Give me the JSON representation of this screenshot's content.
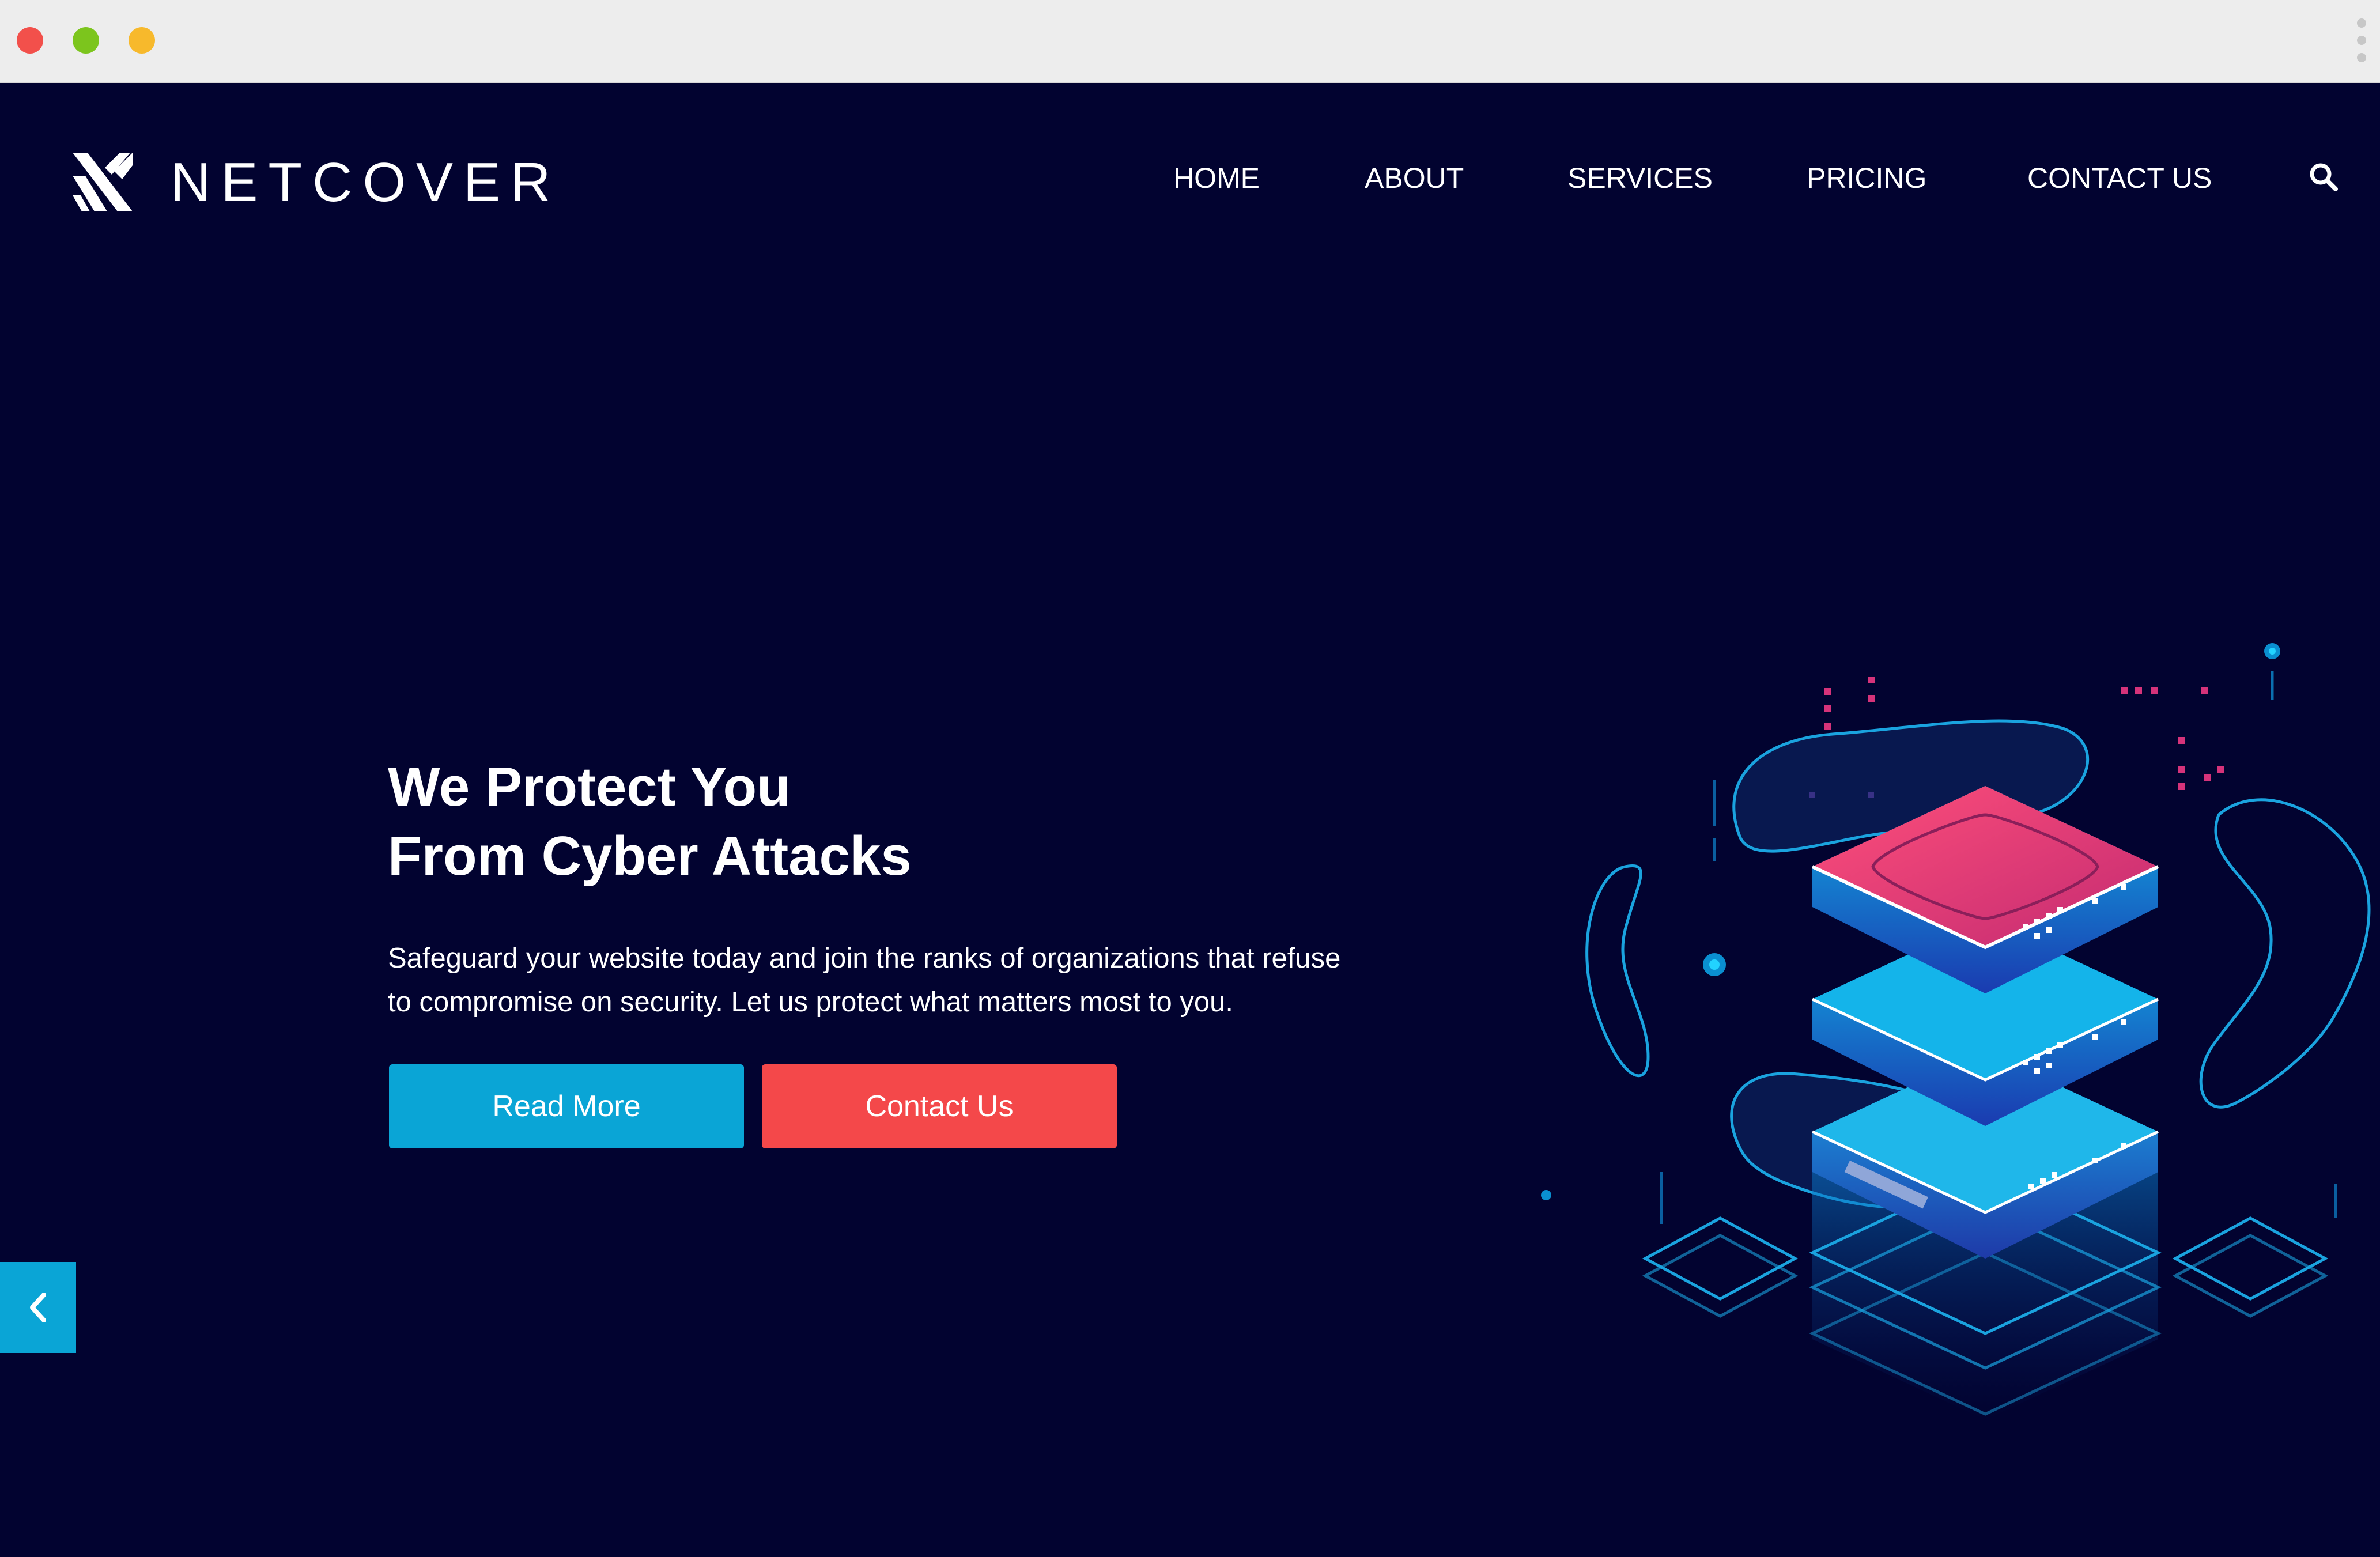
{
  "window": {
    "controls": [
      "close",
      "minimize",
      "maximize"
    ],
    "menu_icon": "kebab-icon"
  },
  "brand": {
    "name": "NETCOVER",
    "logo_icon": "netcover-logo-icon"
  },
  "nav": {
    "items": [
      {
        "label": "HOME"
      },
      {
        "label": "ABOUT"
      },
      {
        "label": "SERVICES"
      },
      {
        "label": "PRICING"
      },
      {
        "label": "CONTACT US"
      }
    ],
    "search_icon": "search-icon"
  },
  "hero": {
    "title_line1": "We Protect You",
    "title_line2": "From Cyber Attacks",
    "text_line1": "Safeguard your website today and join the ranks of organizations that refuse",
    "text_line2": "to compromise on security. Let us protect what matters most to you.",
    "read_more_label": "Read More",
    "contact_label": "Contact Us",
    "prev_icon": "chevron-left-icon",
    "illustration_icon": "server-stack-illustration"
  },
  "colors": {
    "background": "#020330",
    "primary": "#0aa5d6",
    "accent": "#f4484a",
    "text": "#ffffff"
  }
}
